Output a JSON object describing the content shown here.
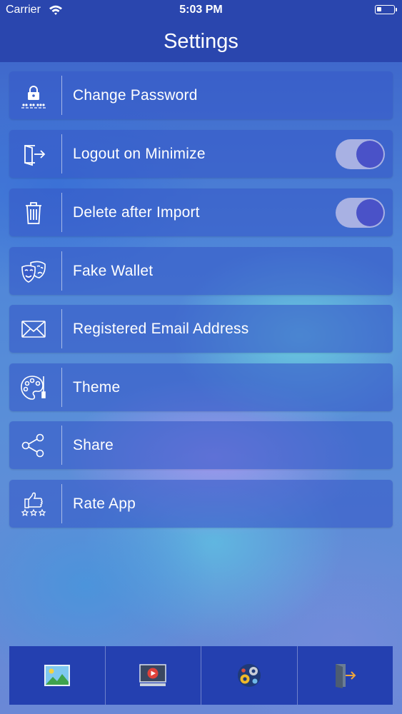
{
  "status_bar": {
    "carrier": "Carrier",
    "time": "5:03 PM"
  },
  "nav": {
    "title": "Settings"
  },
  "settings": [
    {
      "label": "Change Password",
      "icon": "lock-password-icon",
      "toggle": null
    },
    {
      "label": "Logout on Minimize",
      "icon": "logout-door-icon",
      "toggle": true
    },
    {
      "label": "Delete after Import",
      "icon": "trash-icon",
      "toggle": true
    },
    {
      "label": "Fake Wallet",
      "icon": "theater-masks-icon",
      "toggle": null
    },
    {
      "label": "Registered Email Address",
      "icon": "envelope-icon",
      "toggle": null
    },
    {
      "label": "Theme",
      "icon": "palette-icon",
      "toggle": null
    },
    {
      "label": "Share",
      "icon": "share-icon",
      "toggle": null
    },
    {
      "label": "Rate App",
      "icon": "thumbs-up-stars-icon",
      "toggle": null
    }
  ],
  "tab_bar": [
    "photos-tab-icon",
    "videos-tab-icon",
    "settings-gears-tab-icon",
    "exit-door-tab-icon"
  ]
}
